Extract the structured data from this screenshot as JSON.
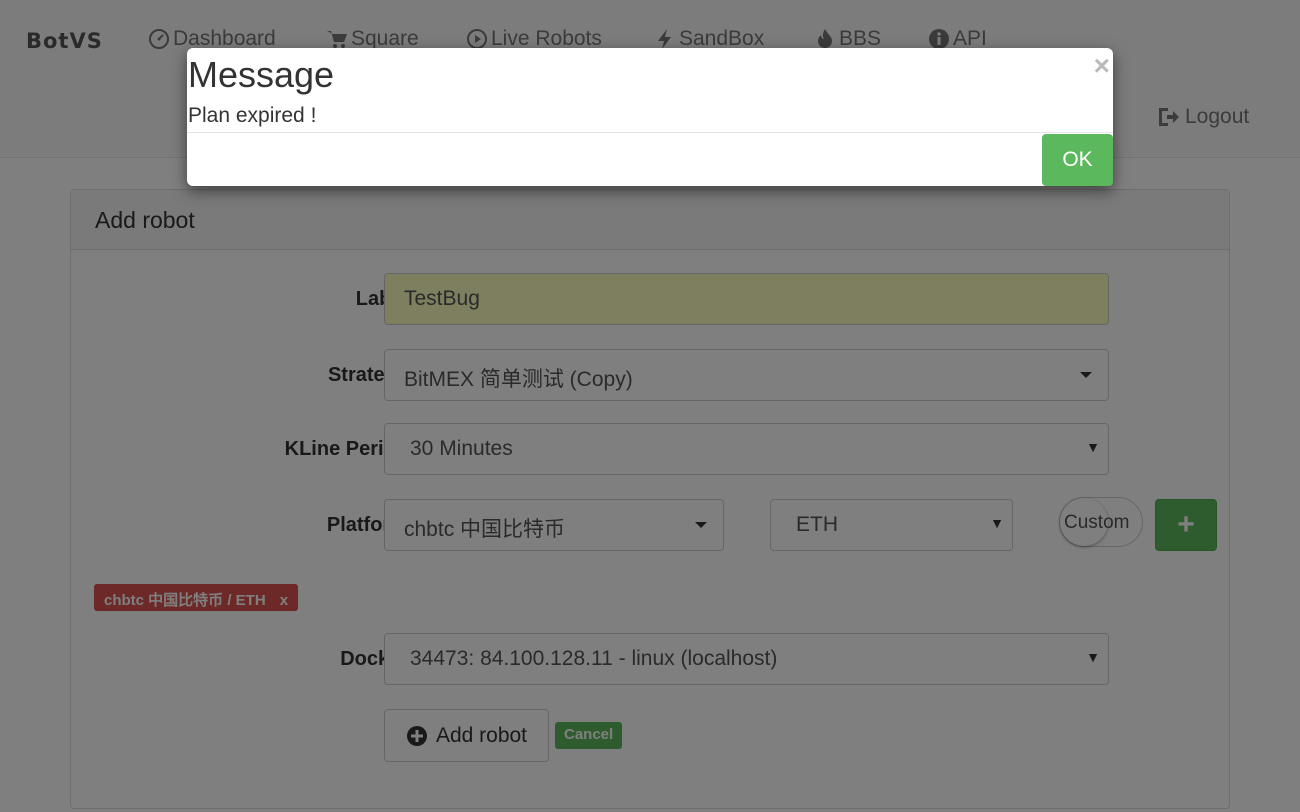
{
  "navbar": {
    "brand": "BotVS",
    "items": [
      {
        "label": "Dashboard",
        "icon": "dashboard-icon"
      },
      {
        "label": "Square",
        "icon": "cart-icon"
      },
      {
        "label": "Live Robots",
        "icon": "play-circle-icon"
      },
      {
        "label": "SandBox",
        "icon": "flash-icon"
      },
      {
        "label": "BBS",
        "icon": "fire-icon"
      },
      {
        "label": "API",
        "icon": "info-circle-icon"
      }
    ],
    "logout_label": "Logout"
  },
  "panel": {
    "title": "Add robot",
    "fields": {
      "label": {
        "label": "Label",
        "value": "TestBug"
      },
      "strategy": {
        "label": "Strategy",
        "value": "BitMEX 简单测试 (Copy)"
      },
      "kline": {
        "label": "KLine Period",
        "value": "30 Minutes"
      },
      "platform": {
        "label": "Platform",
        "value": "chbtc 中国比特币",
        "currency": "ETH",
        "toggle_label": "Custom",
        "add_button": "+"
      },
      "docker": {
        "label": "Docker",
        "value": "34473: 84.100.128.11 - linux (localhost)"
      }
    },
    "platform_tag": {
      "text": "chbtc 中国比特币 / ETH",
      "remove": "x"
    },
    "add_robot_button": "Add robot",
    "cancel_button": "Cancel"
  },
  "modal": {
    "title": "Message",
    "body": "Plan expired !",
    "close": "×",
    "ok_button": "OK"
  },
  "colors": {
    "success": "#5cb85c",
    "danger": "#d9534f",
    "autofill": "#faffbd"
  }
}
